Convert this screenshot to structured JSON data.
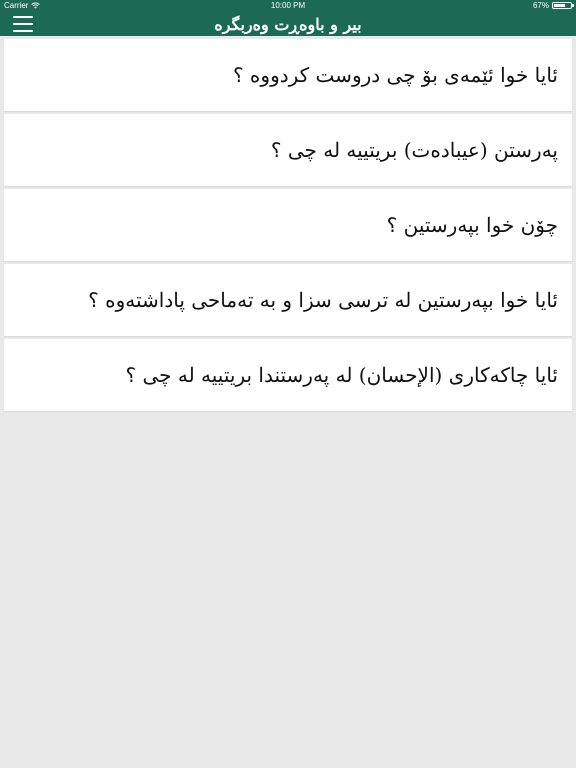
{
  "status_bar": {
    "carrier": "Carrier",
    "time": "10:00 PM",
    "battery_percent": "67%",
    "battery_level": 0.67
  },
  "navbar": {
    "title": "بیر و باوەڕت وەربگرە",
    "menu_icon": "hamburger-menu-icon"
  },
  "colors": {
    "header_bg": "#1d6a54",
    "page_bg": "#e9e9e9",
    "card_bg": "#ffffff"
  },
  "questions": [
    "ئایا خوا ئێمەی بۆ چی دروست کردووە ؟",
    "پەرستن (عیبادەت) بریتییە لە چی ؟",
    "چۆن خوا بپەرستین ؟",
    "ئایا خوا بپەرستین لە ترسی سزا و بە تەماحی پاداشتەوە ؟",
    "ئایا چاکەکاری (الإحسان) لە پەرستندا بریتییە لە چی ؟"
  ]
}
